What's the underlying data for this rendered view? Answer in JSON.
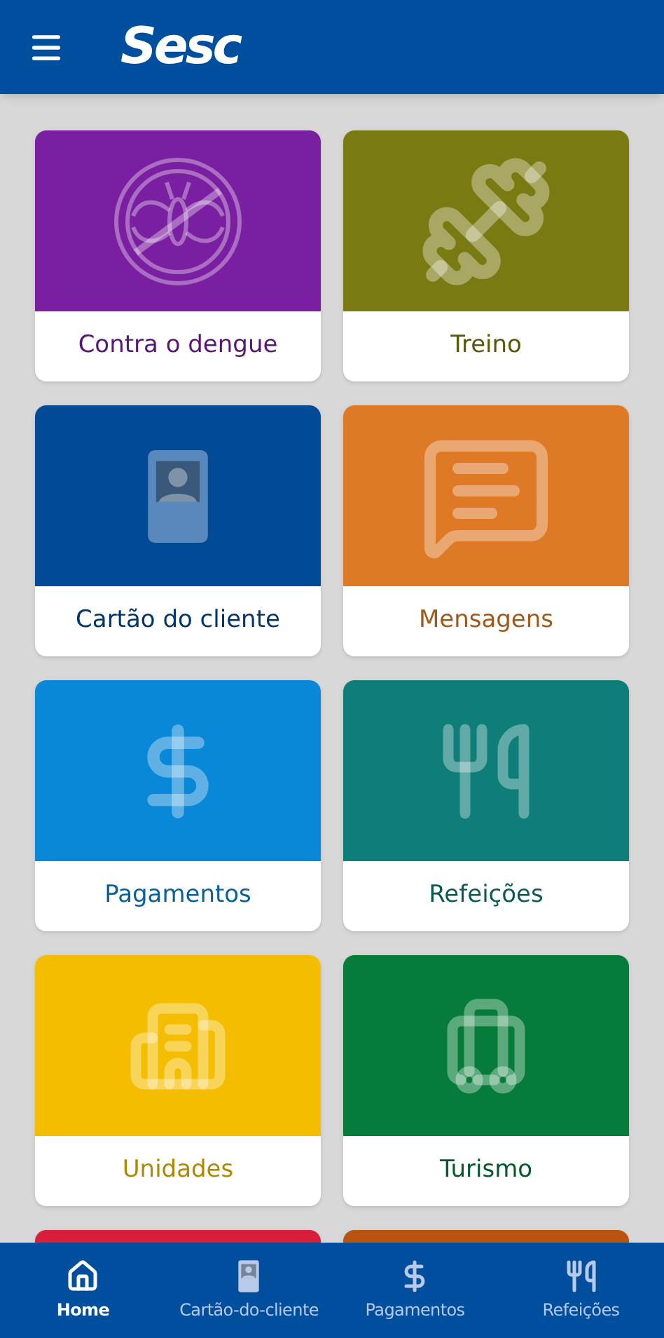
{
  "app_bar": {
    "logo": "Sesc"
  },
  "tiles": [
    {
      "kind": "dengue",
      "label": "Contra o dengue",
      "color": "#7b1fa2"
    },
    {
      "kind": "training",
      "label": "Treino",
      "color": "#7a7a12"
    },
    {
      "kind": "card",
      "label": "Cartão do cliente",
      "color": "#004a98"
    },
    {
      "kind": "messages",
      "label": "Mensagens",
      "color": "#de7a26"
    },
    {
      "kind": "payments",
      "label": "Pagamentos",
      "color": "#0a88d8"
    },
    {
      "kind": "meals",
      "label": "Refeições",
      "color": "#0f7d78"
    },
    {
      "kind": "units",
      "label": "Unidades",
      "color": "#f5bd00"
    },
    {
      "kind": "tourism",
      "label": "Turismo",
      "color": "#067b3a"
    },
    {
      "kind": "partial",
      "color": "#d81e3a"
    },
    {
      "kind": "partial",
      "color": "#b85410"
    }
  ],
  "bottom_nav": [
    {
      "kind": "home",
      "label": "Home",
      "selected": true
    },
    {
      "kind": "card",
      "label": "Cartão-do-cliente",
      "selected": false
    },
    {
      "kind": "payments",
      "label": "Pagamentos",
      "selected": false
    },
    {
      "kind": "meals",
      "label": "Refeições",
      "selected": false
    }
  ]
}
